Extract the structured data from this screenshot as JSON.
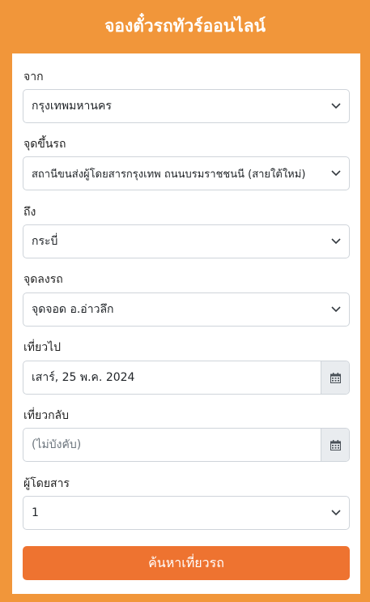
{
  "header": {
    "title": "จองตั๋วรถทัวร์ออนไลน์"
  },
  "form": {
    "from": {
      "label": "จาก",
      "value": "กรุงเทพมหานคร"
    },
    "boarding_point": {
      "label": "จุดขึ้นรถ",
      "value": "สถานีขนส่งผู้โดยสารกรุงเทพ ถนนบรมราชชนนี (สายใต้ใหม่)"
    },
    "to": {
      "label": "ถึง",
      "value": "กระบี่"
    },
    "dropoff_point": {
      "label": "จุดลงรถ",
      "value": "จุดจอด อ.อ่าวลึก"
    },
    "depart": {
      "label": "เที่ยวไป",
      "value": "เสาร์, 25 พ.ค. 2024"
    },
    "return": {
      "label": "เที่ยวกลับ",
      "placeholder": "(ไม่บังคับ)"
    },
    "passengers": {
      "label": "ผู้โดยสาร",
      "value": "1"
    },
    "submit_label": "ค้นหาเที่ยวรถ"
  },
  "icons": {
    "dropdown": "chevron-down-icon",
    "calendar": "calendar-icon"
  },
  "colors": {
    "background": "#f1963a",
    "button": "#ee7330",
    "panel": "#ffffff"
  }
}
